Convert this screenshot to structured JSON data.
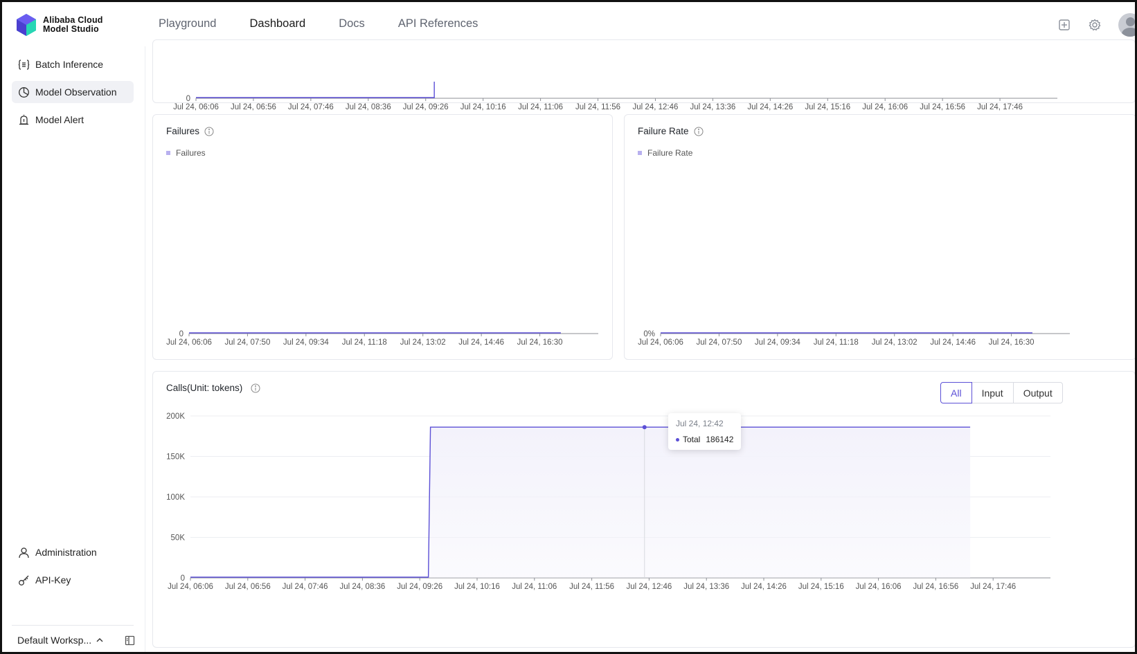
{
  "brand": {
    "line1": "Alibaba Cloud",
    "line2": "Model Studio"
  },
  "nav": [
    {
      "label": "Playground",
      "active": false
    },
    {
      "label": "Dashboard",
      "active": true
    },
    {
      "label": "Docs",
      "active": false
    },
    {
      "label": "API References",
      "active": false
    }
  ],
  "sidebar": {
    "items": [
      {
        "label": "Batch Inference",
        "icon": "braces-list-icon",
        "active": false
      },
      {
        "label": "Model Observation",
        "icon": "pie-chart-icon",
        "active": true
      },
      {
        "label": "Model Alert",
        "icon": "alarm-icon",
        "active": false
      }
    ],
    "bottom_items": [
      {
        "label": "Administration",
        "icon": "user-icon"
      },
      {
        "label": "API-Key",
        "icon": "key-icon"
      }
    ],
    "workspace": "Default Worksp..."
  },
  "colors": {
    "accent": "#5b4fd6",
    "legend": "#b8b0ef",
    "fill": "#f3f2fb"
  },
  "chart_data": [
    {
      "id": "top-partial",
      "type": "line",
      "y_ticks": [
        "0"
      ],
      "x_ticks": [
        "Jul 24, 06:06",
        "Jul 24, 06:56",
        "Jul 24, 07:46",
        "Jul 24, 08:36",
        "Jul 24, 09:26",
        "Jul 24, 10:16",
        "Jul 24, 11:06",
        "Jul 24, 11:56",
        "Jul 24, 12:46",
        "Jul 24, 13:36",
        "Jul 24, 14:26",
        "Jul 24, 15:16",
        "Jul 24, 16:06",
        "Jul 24, 16:56",
        "Jul 24, 17:46"
      ]
    },
    {
      "id": "failures",
      "type": "line",
      "title": "Failures",
      "series": [
        {
          "name": "Failures",
          "values": [
            0,
            0
          ]
        }
      ],
      "y_ticks": [
        "0"
      ],
      "x_ticks": [
        "Jul 24, 06:06",
        "Jul 24, 07:50",
        "Jul 24, 09:34",
        "Jul 24, 11:18",
        "Jul 24, 13:02",
        "Jul 24, 14:46",
        "Jul 24, 16:30"
      ]
    },
    {
      "id": "failure-rate",
      "type": "line",
      "title": "Failure Rate",
      "series": [
        {
          "name": "Failure Rate",
          "values": [
            0,
            0
          ]
        }
      ],
      "y_ticks": [
        "0%"
      ],
      "x_ticks": [
        "Jul 24, 06:06",
        "Jul 24, 07:50",
        "Jul 24, 09:34",
        "Jul 24, 11:18",
        "Jul 24, 13:02",
        "Jul 24, 14:46",
        "Jul 24, 16:30"
      ]
    },
    {
      "id": "calls",
      "type": "area",
      "title": "Calls(Unit: tokens)",
      "ylim": [
        0,
        200000
      ],
      "y_ticks": [
        "200K",
        "150K",
        "100K",
        "50K",
        "0"
      ],
      "x_ticks": [
        "Jul 24, 06:06",
        "Jul 24, 06:56",
        "Jul 24, 07:46",
        "Jul 24, 08:36",
        "Jul 24, 09:26",
        "Jul 24, 10:16",
        "Jul 24, 11:06",
        "Jul 24, 11:56",
        "Jul 24, 12:46",
        "Jul 24, 13:36",
        "Jul 24, 14:26",
        "Jul 24, 15:16",
        "Jul 24, 16:06",
        "Jul 24, 16:56",
        "Jul 24, 17:46"
      ],
      "series": [
        {
          "name": "Total",
          "values": [
            0,
            0,
            186142,
            186142
          ]
        }
      ],
      "segmented": [
        "All",
        "Input",
        "Output"
      ],
      "segmented_active": "All",
      "tooltip": {
        "time": "Jul 24, 12:42",
        "series": "Total",
        "value": "186142"
      }
    }
  ]
}
